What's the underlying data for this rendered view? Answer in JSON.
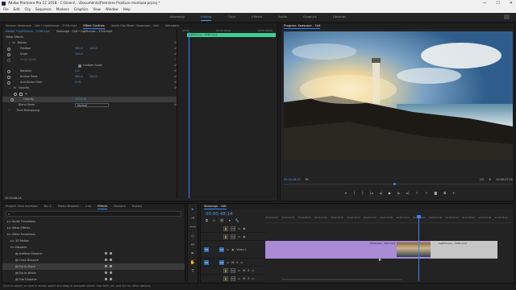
{
  "window": {
    "title": "Adobe Premiere Pro CC 2018 - C:\\Users\\...\\Documents\\Premiere Pro\\Euro montaza.prproj *",
    "controls": [
      "—",
      "☐",
      "✕"
    ]
  },
  "menu": [
    "File",
    "Edit",
    "Clip",
    "Sequence",
    "Markers",
    "Graphics",
    "View",
    "Window",
    "Help"
  ],
  "workspaces": {
    "items": [
      "Assembly",
      "Editing",
      "Color",
      "Effects",
      "Audio",
      "Graphics",
      "Libraries"
    ],
    "active": "Editing"
  },
  "effect_controls": {
    "tabs": [
      "Source: Seascape - 1bit * Lighthouse - 3796.mp4",
      "Effect Controls",
      "Audio Clip Mixer: Seascape - 1bit",
      "Metadata"
    ],
    "active_tab": "Effect Controls",
    "master": "Master * Lighthouse - 3796.mp4",
    "sequence": "Seascape - 1bit * Lighthouse - 3796.mp4",
    "section": "Video Effects",
    "motion": "Motion",
    "rows": [
      {
        "label": "Position",
        "v1": "960.0",
        "v2": "540.0"
      },
      {
        "label": "Scale",
        "v1": "100.0",
        "v2": ""
      },
      {
        "label": "Scale Width",
        "v1": "",
        "v2": ""
      },
      {
        "label": "",
        "v1": "Uniform Scale",
        "v2": ""
      },
      {
        "label": "Rotation",
        "v1": "0.0",
        "v2": ""
      },
      {
        "label": "Anchor Point",
        "v1": "960.0",
        "v2": "540.0"
      },
      {
        "label": "Anti-flicker Filter",
        "v1": "0.00",
        "v2": ""
      }
    ],
    "opacity": "Opacity",
    "opacity_value": "100.0 %",
    "blend_mode_label": "Blend Mode",
    "blend_mode": "Normal",
    "time_remap": "Time Remapping",
    "timecode": "00:00:48:14",
    "clip_bar": "Lighthouse - 3796.mp4",
    "ruler": [
      "00:00",
      "00:00:04:00",
      "00:00:08:00"
    ]
  },
  "program": {
    "title": "Program: Seascape - 1bit",
    "timecode": "00:00:48:14",
    "fit": "Fit",
    "fraction": "1/2",
    "duration": "00:00:07:20"
  },
  "project": {
    "tabs": [
      "Project: Euro montaza",
      "Bin 2",
      "Media Browser",
      "Info",
      "Effects",
      "Markers",
      "History"
    ],
    "active_tab": "Effects",
    "items": [
      {
        "label": "Audio Transitions",
        "level": 1,
        "sel": false
      },
      {
        "label": "Video Effects",
        "level": 1,
        "sel": false
      },
      {
        "label": "Video Transitions",
        "level": 1,
        "sel": false
      },
      {
        "label": "3D Motion",
        "level": 2,
        "sel": false
      },
      {
        "label": "Dissolve",
        "level": 2,
        "sel": false
      },
      {
        "label": "Additive Dissolve",
        "level": 3,
        "sel": false
      },
      {
        "label": "Cross Dissolve",
        "level": 3,
        "sel": false
      },
      {
        "label": "Dip to Black",
        "level": 3,
        "sel": true
      },
      {
        "label": "Dip to White",
        "level": 3,
        "sel": false
      },
      {
        "label": "Film Dissolve",
        "level": 3,
        "sel": false
      },
      {
        "label": "Morph Cut",
        "level": 3,
        "sel": false
      }
    ]
  },
  "timeline": {
    "tab": "Seascape - 1bit",
    "timecode": "00:00:48:14",
    "ruler": [
      "00:00:00:00",
      "00:00:04:00",
      "00:00:08:00",
      "00:00:12:00",
      "00:00:16:00",
      "00:00:20:00",
      "00:00:24:00",
      "00:00:28:00",
      "00:00:32:00",
      "00:00:36:00",
      "00:00:40:00",
      "00:00:44:00",
      "00:00:48:00",
      "00:00:52:00",
      "00:00:56:00"
    ],
    "video_tracks": [
      "V3",
      "V2",
      "V1"
    ],
    "audio_tracks": [
      "A1",
      "A2",
      "A3"
    ],
    "clip1": "Seascape - 1bit.mp4",
    "clip2": "Lighthouse - 3796.mp4",
    "video1": "Video 1"
  },
  "status": "Click to select, or click in empty space and drag to marquee select. Use Shift, Alt, and Ctrl for other options.",
  "colors": {
    "accent": "#4a9be0",
    "clip_purple": "#a98bd6",
    "clip_green": "#3fcf8e",
    "playhead": "#3b82f6"
  }
}
